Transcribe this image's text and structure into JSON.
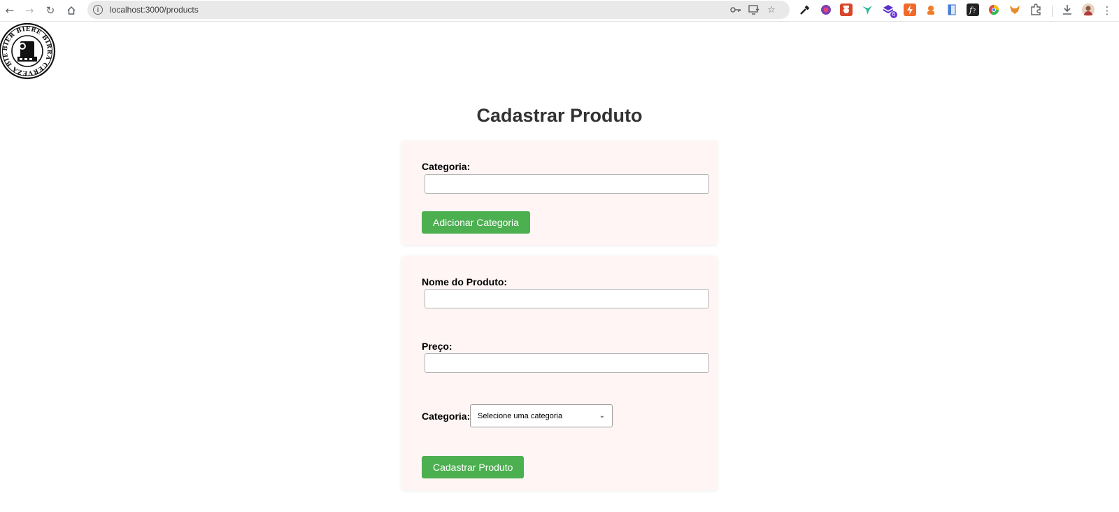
{
  "browser": {
    "url": "localhost:3000/products",
    "info_glyph": "i",
    "nav_icons": [
      "back-icon",
      "forward-icon",
      "reload-icon",
      "home-icon"
    ],
    "omnibox_icons": [
      "password-key-icon",
      "install-app-icon",
      "bookmark-star-icon"
    ],
    "extensions": [
      {
        "name": "eyedropper-extension-icon",
        "color": "#1f1f1f"
      },
      {
        "name": "color-wheel-extension-icon",
        "color": "#7b3fb0"
      },
      {
        "name": "camera-extension-icon",
        "color": "#d9462b"
      },
      {
        "name": "hummingbird-extension-icon",
        "color": "#1db992"
      },
      {
        "name": "stack-extension-icon",
        "color": "#5b2fc9",
        "badge": "6"
      },
      {
        "name": "bolt-extension-icon",
        "color": "#ef6a2b"
      },
      {
        "name": "mascot-extension-icon",
        "color": "#f07c2a"
      },
      {
        "name": "document-extension-icon",
        "color": "#4a7fd6"
      },
      {
        "name": "font-extension-icon",
        "color": "#222222"
      },
      {
        "name": "chrome-color-extension-icon",
        "color": "#e04b3f"
      },
      {
        "name": "fox-extension-icon",
        "color": "#e88b2c"
      },
      {
        "name": "puzzle-extensions-icon",
        "color": "#5f6368"
      }
    ],
    "right_icons": [
      "download-icon",
      "profile-avatar",
      "menu-kebab-icon"
    ]
  },
  "logo": {
    "ring_text": "BIER BIERE BIRRA CERVEZA BIER",
    "name": "beer-stamp-logo"
  },
  "page": {
    "title": "Cadastrar Produto"
  },
  "category_form": {
    "label": "Categoria:",
    "input_value": "",
    "button_label": "Adicionar Categoria"
  },
  "product_form": {
    "name_label": "Nome do Produto:",
    "name_value": "",
    "price_label": "Preço:",
    "price_value": "",
    "category_label": "Categoria:",
    "category_selected": "Selecione uma categoria",
    "submit_label": "Cadastrar Produto"
  },
  "colors": {
    "button_green": "#4caf50",
    "card_background": "#fff5f5",
    "title_text": "#333333"
  }
}
